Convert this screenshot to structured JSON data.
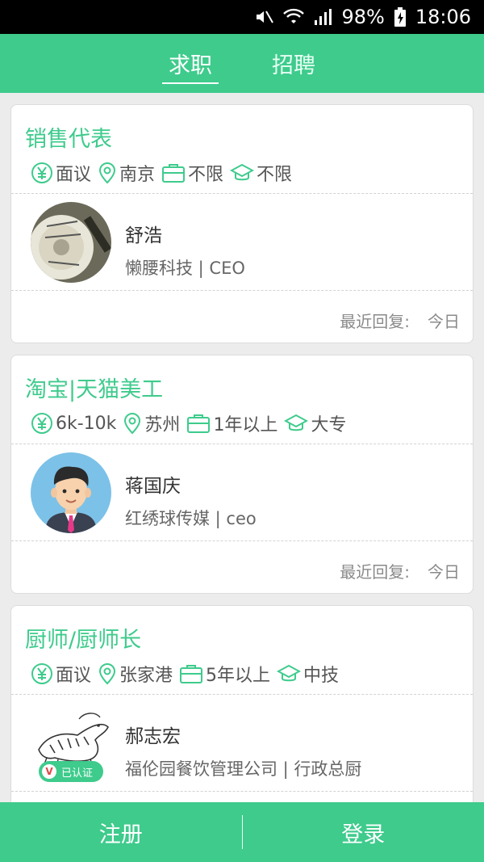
{
  "status_bar": {
    "battery": "98%",
    "time": "18:06"
  },
  "tabs": [
    {
      "label": "求职",
      "active": true
    },
    {
      "label": "招聘",
      "active": false
    }
  ],
  "colors": {
    "accent": "#3ecb8c"
  },
  "cards": [
    {
      "title": "销售代表",
      "salary": "面议",
      "location": "南京",
      "experience": "不限",
      "education": "不限",
      "contact_name": "舒浩",
      "company_role": "懒腰科技 | CEO",
      "reply_label": "最近回复:",
      "reply_value": "今日",
      "avatar": "dial-photo"
    },
    {
      "title": "淘宝|天猫美工",
      "salary": "6k-10k",
      "location": "苏州",
      "experience": "1年以上",
      "education": "大专",
      "contact_name": "蒋国庆",
      "company_role": "红绣球传媒 | ceo",
      "reply_label": "最近回复:",
      "reply_value": "今日",
      "avatar": "cartoon-man"
    },
    {
      "title": "厨师/厨师长",
      "salary": "面议",
      "location": "张家港",
      "experience": "5年以上",
      "education": "中技",
      "contact_name": "郝志宏",
      "company_role": "福伦园餐饮管理公司 | 行政总厨",
      "verified_label": "已认证",
      "avatar": "tiger-sketch"
    }
  ],
  "bottom": {
    "register_label": "注册",
    "login_label": "登录"
  }
}
